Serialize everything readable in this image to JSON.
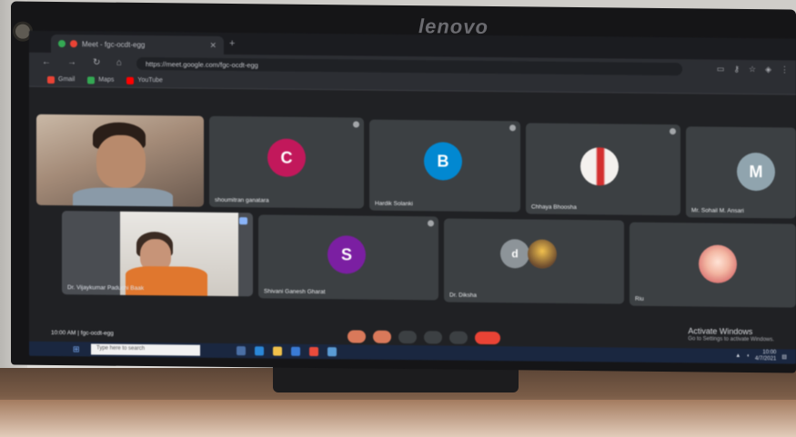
{
  "monitor": {
    "brand": "lenovo"
  },
  "browser": {
    "tab_title": "Meet - fgc-ocdt-egg",
    "url": "https://meet.google.com/fgc-ocdt-egg",
    "bookmarks": [
      {
        "label": "Gmail",
        "color": "#ea4335"
      },
      {
        "label": "Maps",
        "color": "#34a853"
      },
      {
        "label": "YouTube",
        "color": "#ff0000"
      }
    ]
  },
  "meet": {
    "participants": [
      {
        "name": "",
        "type": "video",
        "avatar_letter": ""
      },
      {
        "name": "shoumitran ganatara",
        "type": "letter",
        "avatar_letter": "C",
        "avatar_color": "#c2185b"
      },
      {
        "name": "Hardik Solanki",
        "type": "letter",
        "avatar_letter": "B",
        "avatar_color": "#0288d1"
      },
      {
        "name": "Chhaya Bhoosha",
        "type": "photo",
        "avatar_letter": ""
      },
      {
        "name": "Mr. Sohail M. Ansari",
        "type": "letter",
        "avatar_letter": "M",
        "avatar_color": "#78909c"
      },
      {
        "name": "Dr. Vijaykumar Paduchi Baak",
        "type": "video",
        "avatar_letter": ""
      },
      {
        "name": "Shivani Ganesh Gharat",
        "type": "letter",
        "avatar_letter": "S",
        "avatar_color": "#7b1fa2"
      },
      {
        "name": "Dr. Diksha",
        "type": "group",
        "avatar_letter": "d"
      },
      {
        "name": "Riu",
        "type": "photo",
        "avatar_letter": ""
      }
    ],
    "meeting_info": "10:00 AM | fgc-ocdt-egg",
    "activate_title": "Activate Windows",
    "activate_sub": "Go to Settings to activate Windows."
  },
  "taskbar": {
    "search_placeholder": "Type here to search",
    "time": "10:00",
    "date": "4/7/2021"
  }
}
